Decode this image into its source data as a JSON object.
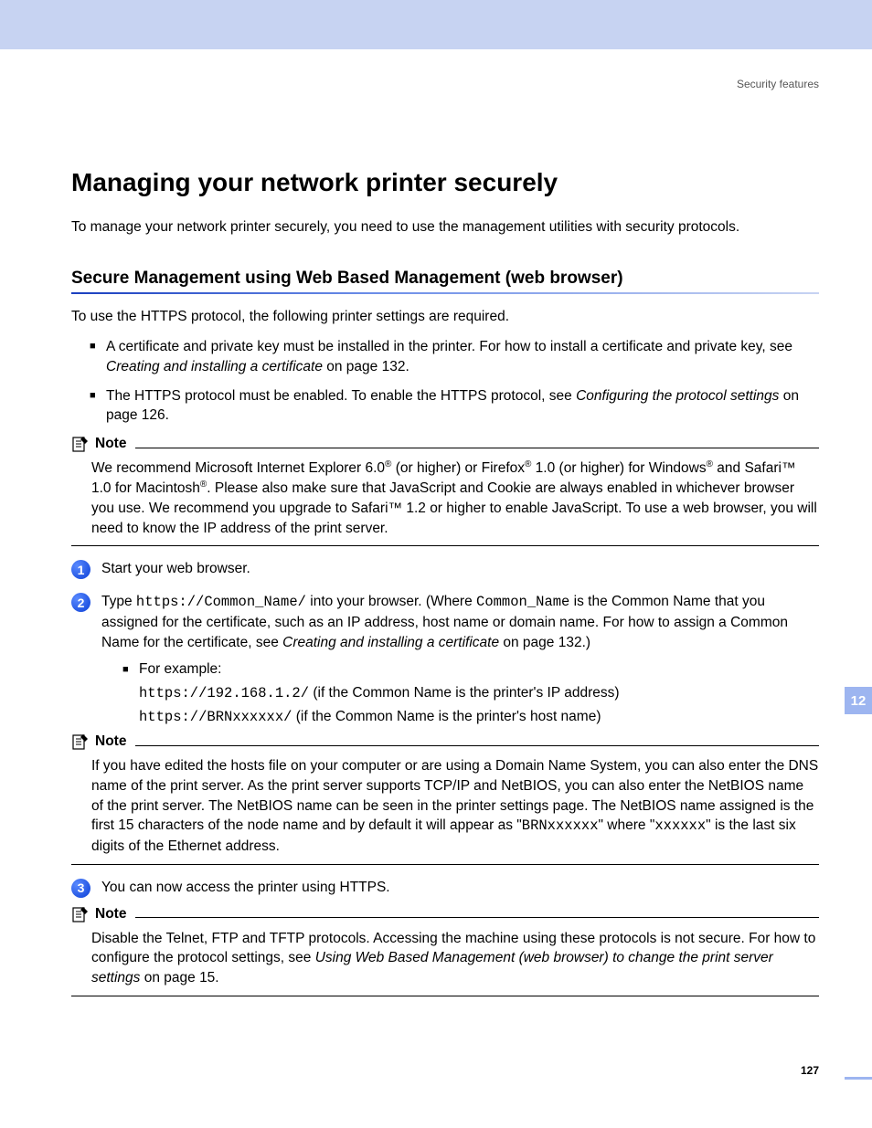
{
  "header": {
    "section": "Security features"
  },
  "h1": "Managing your network printer securely",
  "intro": "To manage your network printer securely, you need to use the management utilities with security protocols.",
  "h2": "Secure Management using Web Based Management (web browser)",
  "p_https_intro": "To use the HTTPS protocol, the following printer settings are required.",
  "bullets": {
    "b1_a": "A certificate and private key must be installed in the printer. For how to install a certificate and private key, see ",
    "b1_i": "Creating and installing a certificate",
    "b1_c": " on page 132.",
    "b2_a": "The HTTPS protocol must be enabled. To enable the HTTPS protocol, see ",
    "b2_i": "Configuring the protocol settings",
    "b2_c": " on page 126."
  },
  "note_label": "Note",
  "note1": {
    "a": "We recommend Microsoft Internet Explorer 6.0",
    "b": " (or higher) or Firefox",
    "c": " 1.0 (or higher) for Windows",
    "d": " and Safari™ 1.0 for Macintosh",
    "e": ". Please also make sure that JavaScript and Cookie are always enabled in whichever browser you use. We recommend you upgrade to Safari™ 1.2 or higher to enable JavaScript. To use a web browser, you will need to know the IP address of the print server."
  },
  "steps": {
    "s1": "Start your web browser.",
    "s2_a": "Type ",
    "s2_code1": "https://Common_Name/",
    "s2_b": " into your browser. (Where ",
    "s2_code2": "Common_Name",
    "s2_c": " is the Common Name that you assigned for the certificate, such as an IP address, host name or domain name. For how to assign a Common Name for the certificate, see ",
    "s2_i": "Creating and installing a certificate",
    "s2_d": " on page 132.)",
    "example_label": "For example:",
    "ex1_code": "https://192.168.1.2/",
    "ex1_text": " (if the Common Name is the printer's IP address)",
    "ex2_code": "https://BRNxxxxxx/",
    "ex2_text": " (if the Common Name is the printer's host name)",
    "s3": "You can now access the printer using HTTPS."
  },
  "note2": {
    "a": "If you have edited the hosts file on your computer or are using a Domain Name System, you can also enter the DNS name of the print server. As the print server supports TCP/IP and NetBIOS, you can also enter the NetBIOS name of the print server. The NetBIOS name can be seen in the printer settings page. The NetBIOS name assigned is the first 15 characters of the node name and by default it will appear as \"",
    "code1": "BRNxxxxxx",
    "b": "\" where \"",
    "code2": "xxxxxx",
    "c": "\" is the last six digits of the Ethernet address."
  },
  "note3": {
    "a": "Disable the Telnet, FTP and TFTP protocols. Accessing the machine using these protocols is not secure. For how to configure the protocol settings, see ",
    "i": "Using Web Based Management (web browser) to change the print server settings",
    "b": " on page 15."
  },
  "side_tab": "12",
  "page_number": "127",
  "reg": "®"
}
